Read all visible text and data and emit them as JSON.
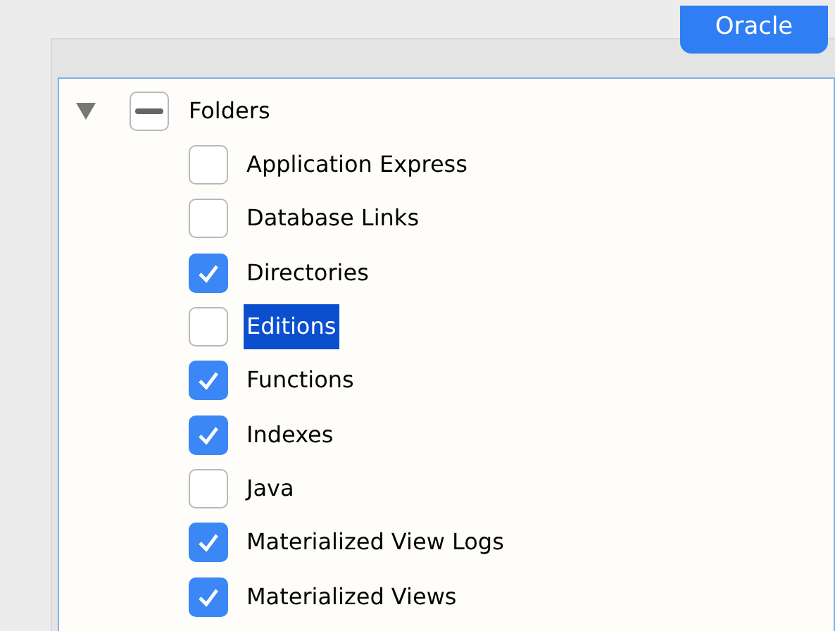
{
  "tabs": [
    {
      "label": "Oracle",
      "selected": true
    }
  ],
  "tree": {
    "label": "Folders",
    "expanded": true,
    "indeterminate": true,
    "selected": false,
    "children": [
      {
        "label": "Application Express",
        "checked": false,
        "selected": false
      },
      {
        "label": "Database Links",
        "checked": false,
        "selected": false
      },
      {
        "label": "Directories",
        "checked": true,
        "selected": false
      },
      {
        "label": "Editions",
        "checked": false,
        "selected": true
      },
      {
        "label": "Functions",
        "checked": true,
        "selected": false
      },
      {
        "label": "Indexes",
        "checked": true,
        "selected": false
      },
      {
        "label": "Java",
        "checked": false,
        "selected": false
      },
      {
        "label": "Materialized View Logs",
        "checked": true,
        "selected": false
      },
      {
        "label": "Materialized Views",
        "checked": true,
        "selected": false
      }
    ]
  }
}
